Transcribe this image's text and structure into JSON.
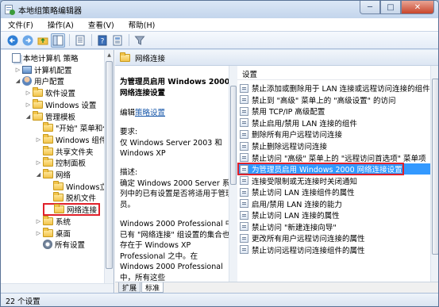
{
  "window": {
    "title": "本地组策略编辑器",
    "minimize": "─",
    "maximize": "□",
    "close": "✕"
  },
  "menu": [
    "文件(F)",
    "操作(A)",
    "查看(V)",
    "帮助(H)"
  ],
  "toolbar_icons": [
    "back-arrow-icon",
    "forward-arrow-icon",
    "up-folder-icon",
    "show-tree-icon",
    "separator",
    "export-list-icon",
    "separator",
    "help-book-icon",
    "properties-icon",
    "separator",
    "filter-icon"
  ],
  "tree": {
    "items": [
      {
        "label": "本地计算机 策略",
        "indent": 0,
        "expander": "",
        "icon": "pages"
      },
      {
        "label": "计算机配置",
        "indent": 1,
        "expander": "▷",
        "icon": "pc"
      },
      {
        "label": "用户配置",
        "indent": 1,
        "expander": "◢",
        "icon": "user"
      },
      {
        "label": "软件设置",
        "indent": 2,
        "expander": "▷",
        "icon": "folder"
      },
      {
        "label": "Windows 设置",
        "indent": 2,
        "expander": "▷",
        "icon": "folder"
      },
      {
        "label": "管理模板",
        "indent": 2,
        "expander": "◢",
        "icon": "folder"
      },
      {
        "label": "\"开始\" 菜单和任务栏",
        "indent": 3,
        "expander": "",
        "icon": "folder"
      },
      {
        "label": "Windows 组件",
        "indent": 3,
        "expander": "▷",
        "icon": "folder"
      },
      {
        "label": "共享文件夹",
        "indent": 3,
        "expander": "",
        "icon": "folder"
      },
      {
        "label": "控制面板",
        "indent": 3,
        "expander": "▷",
        "icon": "folder"
      },
      {
        "label": "网络",
        "indent": 3,
        "expander": "◢",
        "icon": "folder"
      },
      {
        "label": "Windows立即连接",
        "indent": 4,
        "expander": "",
        "icon": "folder"
      },
      {
        "label": "脱机文件",
        "indent": 4,
        "expander": "",
        "icon": "folder"
      },
      {
        "label": "网络连接",
        "indent": 4,
        "expander": "",
        "icon": "folder",
        "highlight": true
      },
      {
        "label": "系统",
        "indent": 3,
        "expander": "▷",
        "icon": "folder"
      },
      {
        "label": "桌面",
        "indent": 3,
        "expander": "▷",
        "icon": "folder"
      },
      {
        "label": "所有设置",
        "indent": 3,
        "expander": "",
        "icon": "gear"
      }
    ]
  },
  "header": {
    "folder_title": "网络连接"
  },
  "description": {
    "policy_title": "为管理员启用 Windows 2000 网络连接设置",
    "edit_prefix": "编辑",
    "edit_link": "策略设置",
    "requirements_label": "要求:",
    "requirements_text": "仅 Windows Server 2003 和 Windows XP",
    "description_label": "描述:",
    "description_text": "确定 Windows 2000 Server 系列中的已有设置是否将适用于管理员。",
    "more_text": "Windows 2000 Professional 中已有 \"网络连接\" 组设置的集合也存在于 Windows XP Professional 之中。在 Windows 2000 Professional 中，所有这些"
  },
  "list": {
    "column_header": "设置",
    "items": [
      "禁止添加或删除用于 LAN 连接或远程访问连接的组件",
      "禁止到 \"高级\" 菜单上的 \"高级设置\" 的访问",
      "禁用 TCP/IP 高级配置",
      "禁止启用/禁用 LAN 连接的组件",
      "删除所有用户远程访问连接",
      "禁止删除远程访问连接",
      "禁止访问 \"高级\" 菜单上的 \"远程访问首选项\" 菜单项",
      "为管理员启用 Windows 2000 网络连接设置",
      "连接受限制或无连接时关闭通知",
      "禁止访问 LAN 连接组件的属性",
      "启用/禁用 LAN 连接的能力",
      "禁止访问 LAN 连接的属性",
      "禁止访问 \"新建连接向导\"",
      "更改所有用户远程访问连接的属性",
      "禁止访问远程访问连接组件的属性"
    ],
    "selected_index": 7
  },
  "tabs": [
    "扩展",
    "标准"
  ],
  "status": {
    "text": "22 个设置"
  }
}
